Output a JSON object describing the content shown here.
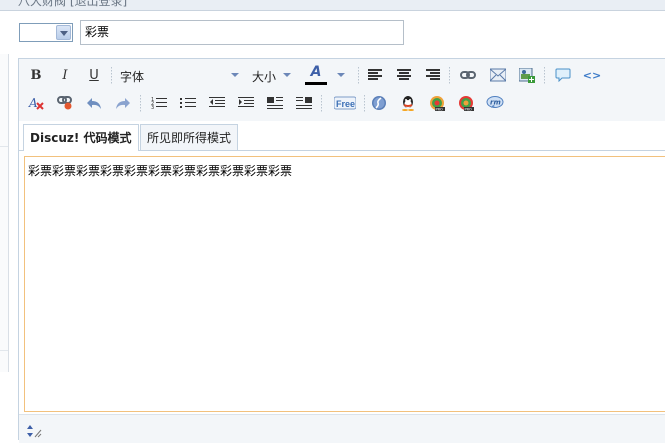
{
  "header": {
    "text": "八大财阀 [退出登录]"
  },
  "form": {
    "type_select_value": "",
    "subject_value": "彩票"
  },
  "toolbar": {
    "bold": "B",
    "italic": "I",
    "underline": "U",
    "font_label": "字体",
    "size_label": "大小",
    "font_color": "A",
    "colors": {
      "font_color_bar": "#000000",
      "editor_border": "#f2c17d",
      "toolbar_bg": "#f3f6f9"
    }
  },
  "tabs": [
    {
      "label": "Discuz! 代码模式",
      "active": true
    },
    {
      "label": "所见即所得模式",
      "active": false
    }
  ],
  "editor": {
    "content": "彩票彩票彩票彩票彩票彩票彩票彩票彩票彩票彩票"
  }
}
